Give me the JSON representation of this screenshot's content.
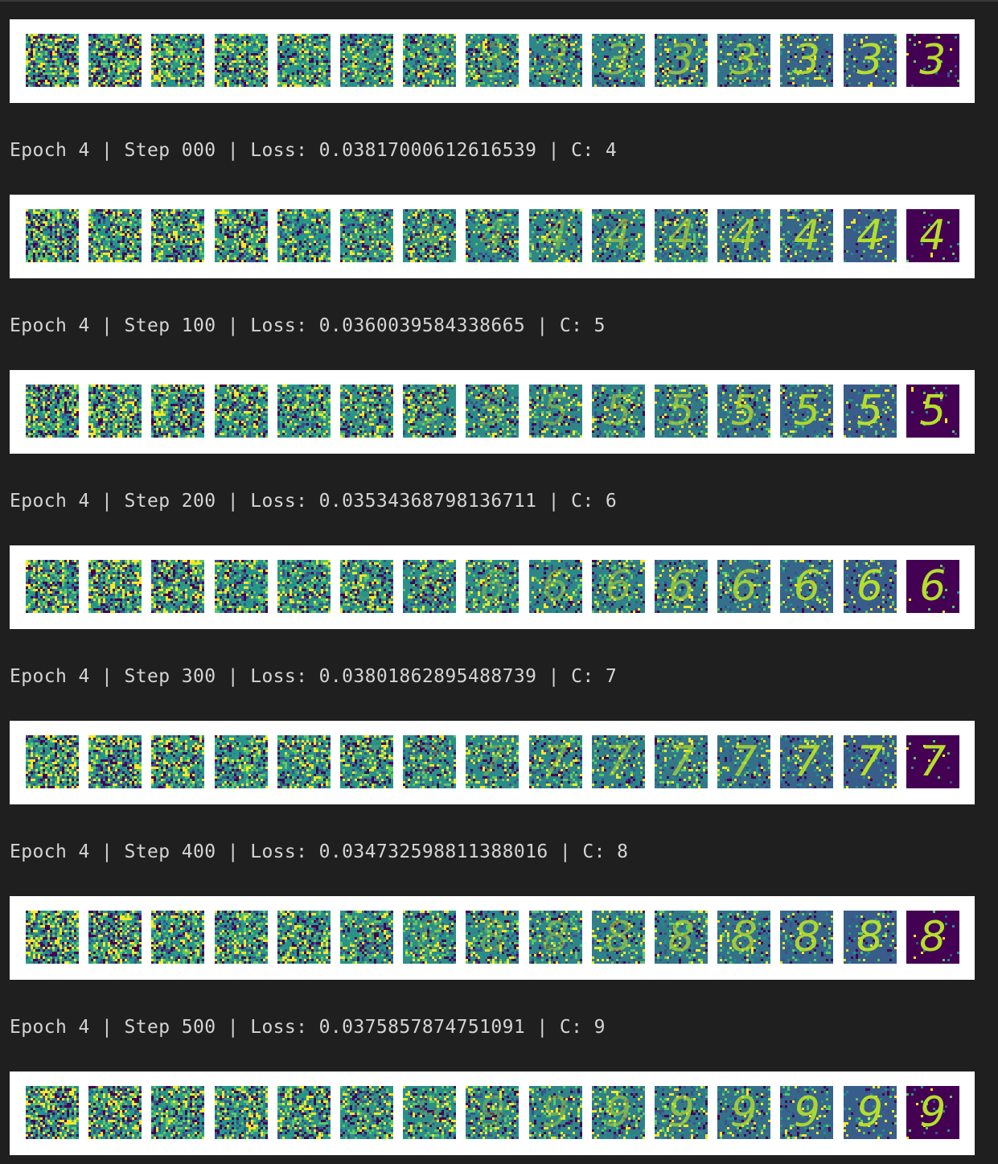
{
  "colors": {
    "background": "#1f1f1f",
    "text": "#d4d4d4",
    "strip_background": "#ffffff",
    "noise_palette": [
      "#440154",
      "#3b528b",
      "#21918c",
      "#5ec962",
      "#fde725"
    ],
    "final_frame_background": "#440154",
    "digit_color": "#b5de2b"
  },
  "frames_per_strip": 15,
  "logs": [
    {
      "epoch": "4",
      "step": "000",
      "loss": "0.03817000612616539",
      "c": "4",
      "text": "Epoch 4 | Step 000 | Loss: 0.03817000612616539 | C: 4"
    },
    {
      "epoch": "4",
      "step": "100",
      "loss": "0.0360039584338665",
      "c": "5",
      "text": "Epoch 4 | Step 100 | Loss: 0.0360039584338665 | C: 5"
    },
    {
      "epoch": "4",
      "step": "200",
      "loss": "0.03534368798136711",
      "c": "6",
      "text": "Epoch 4 | Step 200 | Loss: 0.03534368798136711 | C: 6"
    },
    {
      "epoch": "4",
      "step": "300",
      "loss": "0.03801862895488739",
      "c": "7",
      "text": "Epoch 4 | Step 300 | Loss: 0.03801862895488739 | C: 7"
    },
    {
      "epoch": "4",
      "step": "400",
      "loss": "0.034732598811388016",
      "c": "8",
      "text": "Epoch 4 | Step 400 | Loss: 0.034732598811388016 | C: 8"
    },
    {
      "epoch": "4",
      "step": "500",
      "loss": "0.0375857874751091",
      "c": "9",
      "text": "Epoch 4 | Step 500 | Loss: 0.0375857874751091 | C: 9"
    }
  ],
  "strips": [
    {
      "digit": "3"
    },
    {
      "digit": "4"
    },
    {
      "digit": "5"
    },
    {
      "digit": "6"
    },
    {
      "digit": "7"
    },
    {
      "digit": "8"
    },
    {
      "digit": "9"
    }
  ]
}
